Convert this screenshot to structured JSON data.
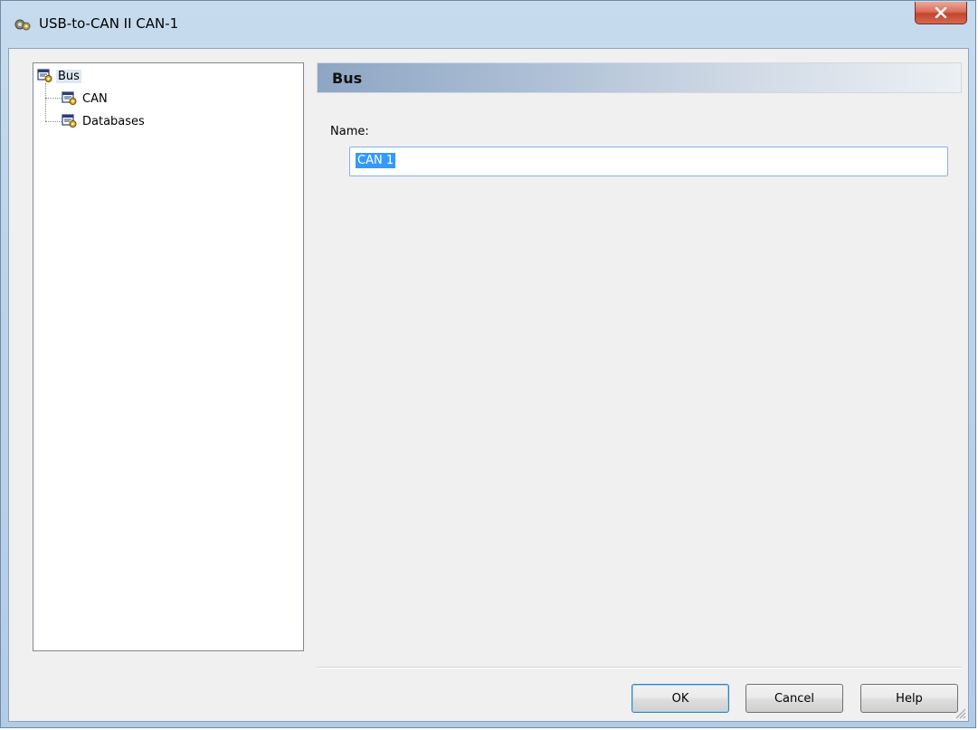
{
  "window": {
    "title": "USB-to-CAN II CAN-1",
    "close_icon": "close-icon"
  },
  "tree": {
    "items": [
      {
        "label": "Bus",
        "icon": "bus-config-icon",
        "selected": true
      },
      {
        "label": "CAN",
        "icon": "bus-config-icon",
        "selected": false
      },
      {
        "label": "Databases",
        "icon": "bus-config-icon",
        "selected": false
      }
    ]
  },
  "panel": {
    "title": "Bus",
    "name_label": "Name:",
    "name_value": "CAN 1"
  },
  "buttons": {
    "ok": "OK",
    "cancel": "Cancel",
    "help": "Help"
  },
  "colors": {
    "selection": "#3399ff",
    "close_button": "#c5442c"
  }
}
